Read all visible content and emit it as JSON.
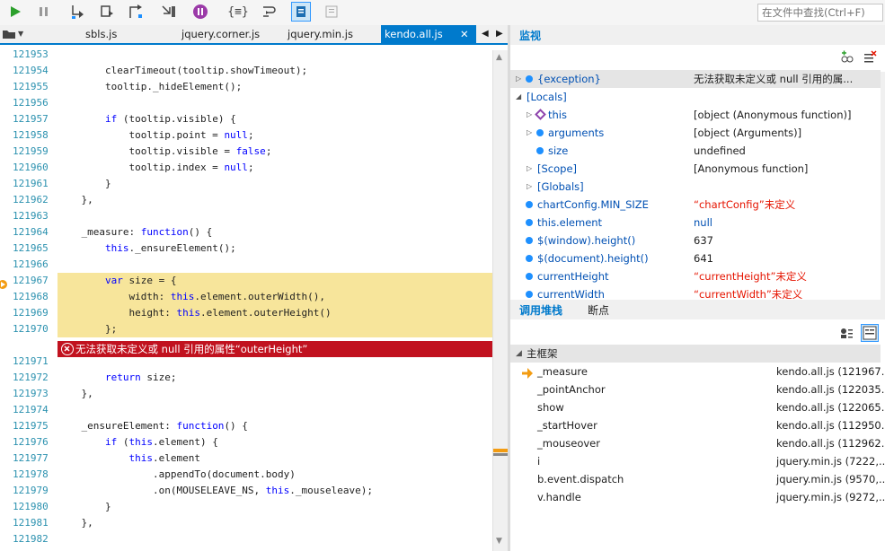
{
  "toolbar": {
    "search_placeholder": "在文件中查找(Ctrl+F)",
    "icons": [
      "continue-icon",
      "pause-icon",
      "step-into-icon",
      "step-over-icon",
      "step-out-icon",
      "step-back-icon",
      "break-exception-icon",
      "format-icon",
      "wrap-icon",
      "just-my-code-icon",
      "restore-icon"
    ]
  },
  "editor": {
    "tabs": [
      {
        "label": "sbls.js"
      },
      {
        "label": "jquery.corner.js"
      },
      {
        "label": "jquery.min.js"
      },
      {
        "label": "kendo.all.js",
        "active": true
      }
    ],
    "close_glyph": "✕",
    "error_message": "无法获取未定义或 null 引用的属性“outerHeight”",
    "lines": [
      {
        "num": "121953",
        "code": ""
      },
      {
        "num": "121954",
        "code": "        clearTimeout(tooltip.showTimeout);"
      },
      {
        "num": "121955",
        "code": "        tooltip._hideElement();"
      },
      {
        "num": "121956",
        "code": ""
      },
      {
        "num": "121957",
        "code": "        if (tooltip.visible) {"
      },
      {
        "num": "121958",
        "code": "            tooltip.point = null;"
      },
      {
        "num": "121959",
        "code": "            tooltip.visible = false;"
      },
      {
        "num": "121960",
        "code": "            tooltip.index = null;"
      },
      {
        "num": "121961",
        "code": "        }"
      },
      {
        "num": "121962",
        "code": "    },"
      },
      {
        "num": "121963",
        "code": ""
      },
      {
        "num": "121964",
        "code": "    _measure: function() {"
      },
      {
        "num": "121965",
        "code": "        this._ensureElement();"
      },
      {
        "num": "121966",
        "code": ""
      },
      {
        "num": "121967",
        "code": "        var size = {"
      },
      {
        "num": "121968",
        "code": "            width: this.element.outerWidth(),"
      },
      {
        "num": "121969",
        "code": "            height: this.element.outerHeight()"
      },
      {
        "num": "121970",
        "code": "        };"
      },
      {
        "num": "121971",
        "code": ""
      },
      {
        "num": "121972",
        "code": "        return size;"
      },
      {
        "num": "121973",
        "code": "    },"
      },
      {
        "num": "121974",
        "code": ""
      },
      {
        "num": "121975",
        "code": "    _ensureElement: function() {"
      },
      {
        "num": "121976",
        "code": "        if (this.element) {"
      },
      {
        "num": "121977",
        "code": "            this.element"
      },
      {
        "num": "121978",
        "code": "                .appendTo(document.body)"
      },
      {
        "num": "121979",
        "code": "                .on(MOUSELEAVE_NS, this._mouseleave);"
      },
      {
        "num": "121980",
        "code": "        }"
      },
      {
        "num": "121981",
        "code": "    },"
      },
      {
        "num": "121982",
        "code": ""
      }
    ]
  },
  "watch": {
    "title": "监视",
    "rows": [
      {
        "name": "{exception}",
        "value": "无法获取未定义或 null 引用的属...",
        "value_style": "normal",
        "icon": "dot",
        "expander": "▷",
        "indent": 0,
        "selected": true
      },
      {
        "name": "[Locals]",
        "value": "",
        "value_style": "normal",
        "icon": "none",
        "expander": "◢",
        "indent": 0
      },
      {
        "name": "this",
        "value": "[object (Anonymous function)]",
        "value_style": "normal",
        "icon": "cube",
        "expander": "▷",
        "indent": 1
      },
      {
        "name": "arguments",
        "value": "[object (Arguments)]",
        "value_style": "normal",
        "icon": "dot",
        "expander": "▷",
        "indent": 1
      },
      {
        "name": "size",
        "value": "undefined",
        "value_style": "normal",
        "icon": "dot",
        "expander": "",
        "indent": 1
      },
      {
        "name": "[Scope]",
        "value": "[Anonymous function]",
        "value_style": "normal",
        "icon": "none",
        "expander": "▷",
        "indent": 1
      },
      {
        "name": "[Globals]",
        "value": "",
        "value_style": "normal",
        "icon": "none",
        "expander": "▷",
        "indent": 1
      },
      {
        "name": "chartConfig.MIN_SIZE",
        "value": "“chartConfig”未定义",
        "value_style": "err",
        "icon": "dot",
        "expander": "",
        "indent": 0
      },
      {
        "name": "this.element",
        "value": "null",
        "value_style": "blue",
        "icon": "dot",
        "expander": "",
        "indent": 0
      },
      {
        "name": "$(window).height()",
        "value": "637",
        "value_style": "normal",
        "icon": "dot",
        "expander": "",
        "indent": 0
      },
      {
        "name": "$(document).height()",
        "value": "641",
        "value_style": "normal",
        "icon": "dot",
        "expander": "",
        "indent": 0
      },
      {
        "name": "currentHeight",
        "value": "“currentHeight”未定义",
        "value_style": "err",
        "icon": "dot",
        "expander": "",
        "indent": 0
      },
      {
        "name": "currentWidth",
        "value": "“currentWidth”未定义",
        "value_style": "err",
        "icon": "dot",
        "expander": "",
        "indent": 0
      }
    ]
  },
  "callstack": {
    "tab_callstack": "调用堆栈",
    "tab_breakpoints": "断点",
    "group": "主框架",
    "frames": [
      {
        "name": "_measure",
        "location": "kendo.all.js (121967...",
        "current": true
      },
      {
        "name": "_pointAnchor",
        "location": "kendo.all.js (122035..."
      },
      {
        "name": "show",
        "location": "kendo.all.js (122065..."
      },
      {
        "name": "_startHover",
        "location": "kendo.all.js (112950..."
      },
      {
        "name": "_mouseover",
        "location": "kendo.all.js (112962..."
      },
      {
        "name": "i",
        "location": "jquery.min.js (7222,..."
      },
      {
        "name": "b.event.dispatch",
        "location": "jquery.min.js (9570,..."
      },
      {
        "name": "v.handle",
        "location": "jquery.min.js (9272,..."
      }
    ]
  },
  "colors": {
    "accent": "#007acc",
    "error": "#c1121f",
    "highlight": "#f7e59b",
    "keyword": "#0000ff",
    "line_number": "#2b91af"
  }
}
